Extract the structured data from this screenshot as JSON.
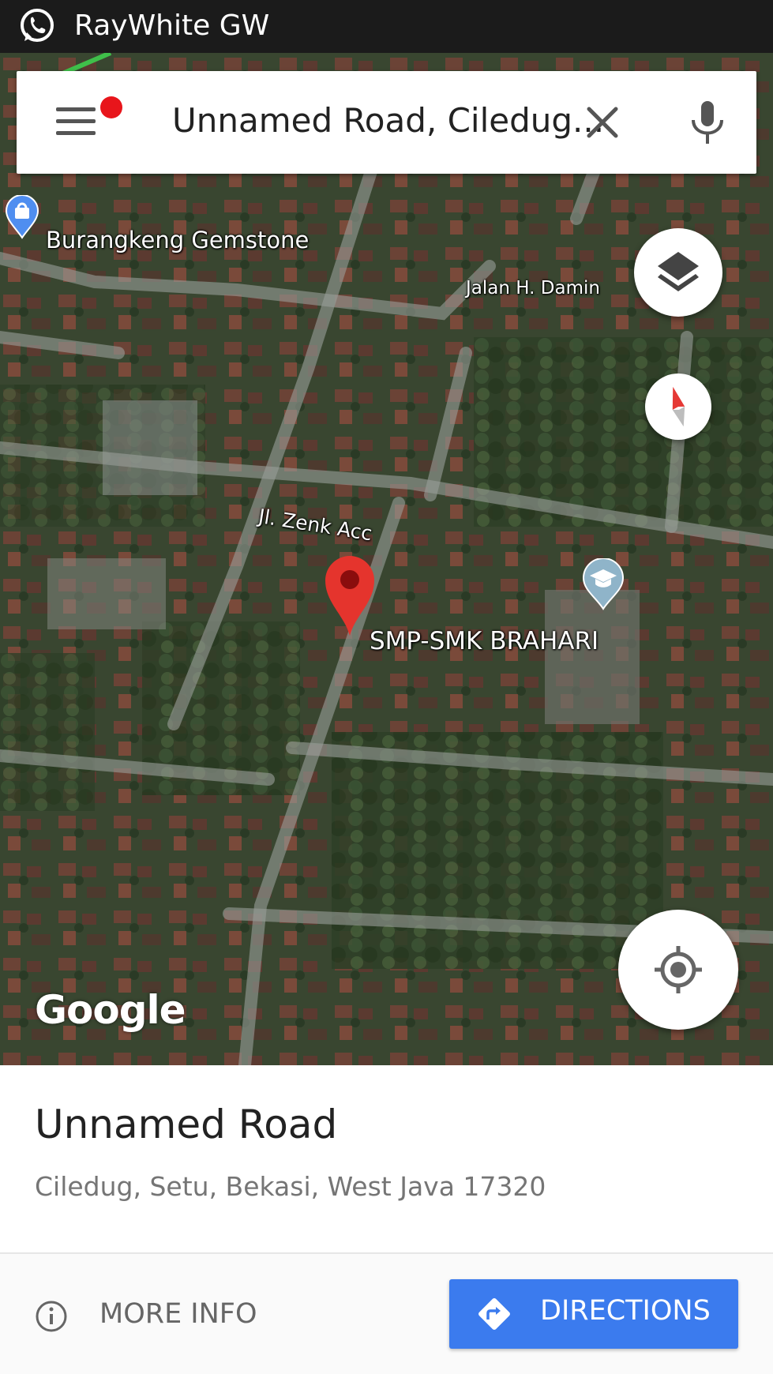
{
  "status_bar": {
    "app_icon": "whatsapp-icon",
    "title": "RayWhite GW"
  },
  "search": {
    "menu_icon": "hamburger-menu-icon",
    "notification_dot_color": "#e8151b",
    "query": "Unnamed Road, Ciledug...",
    "clear_icon": "close-icon",
    "voice_icon": "microphone-icon"
  },
  "map": {
    "type": "satellite",
    "labels": {
      "poi_shop": "Burangkeng Gemstone",
      "street_damin": "Jalan H. Damin",
      "street_zenk": "Jl. Zenk Acc",
      "poi_school": "SMP-SMK BRAHARI"
    },
    "pin_color": "#e5342d",
    "attribution": "Google",
    "controls": {
      "layers_icon": "layers-icon",
      "compass_icon": "compass-icon",
      "my_location_icon": "my-location-icon"
    }
  },
  "place": {
    "title": "Unnamed Road",
    "address": "Ciledug, Setu, Bekasi, West Java 17320"
  },
  "actions": {
    "more_info": "MORE INFO",
    "directions": "DIRECTIONS",
    "directions_color": "#3b7bee"
  }
}
